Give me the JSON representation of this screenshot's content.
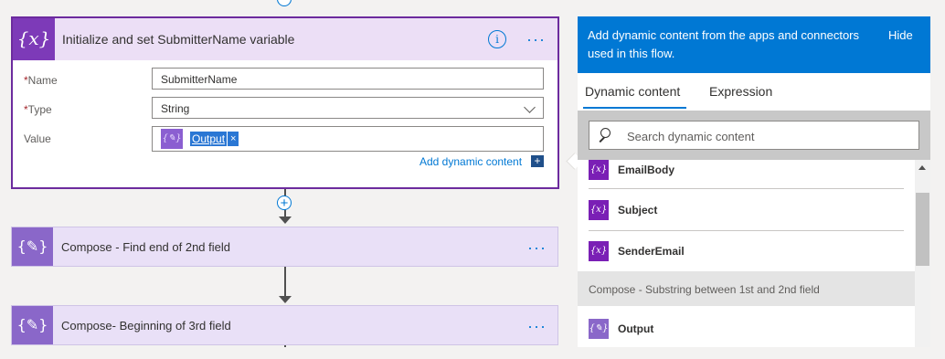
{
  "init_card": {
    "title": "Initialize and set SubmitterName variable",
    "icon": "{x}",
    "info_icon": "i",
    "more": "···",
    "fields": {
      "name_label": "Name",
      "name_value": "SubmitterName",
      "type_label": "Type",
      "type_value": "String",
      "value_label": "Value",
      "value_token": "Output",
      "token_remove": "×",
      "required_mark": "*"
    },
    "add_dynamic": "Add dynamic content",
    "add_dynamic_icon": "+"
  },
  "compose_cards": [
    {
      "title": "Compose - Find end of 2nd field",
      "icon": "{✎}",
      "more": "···"
    },
    {
      "title": "Compose- Beginning of 3rd field",
      "icon": "{✎}",
      "more": "···"
    }
  ],
  "connector_plus": "+",
  "panel": {
    "header_text": "Add dynamic content from the apps and connectors used in this flow.",
    "hide_label": "Hide",
    "tabs": [
      "Dynamic content",
      "Expression"
    ],
    "active_tab": "Dynamic content",
    "search_placeholder": "Search dynamic content",
    "items": [
      {
        "label": "EmailBody",
        "icon": "{x}"
      },
      {
        "label": "Subject",
        "icon": "{x}"
      },
      {
        "label": "SenderEmail",
        "icon": "{x}"
      }
    ],
    "group_header": "Compose - Substring between 1st and 2nd field",
    "group_items": [
      {
        "label": "Output",
        "icon": "{✎}"
      }
    ]
  },
  "colors": {
    "accent": "#0078d4",
    "variable_purple": "#7d3ab8",
    "compose_purple": "#8a67c9"
  }
}
